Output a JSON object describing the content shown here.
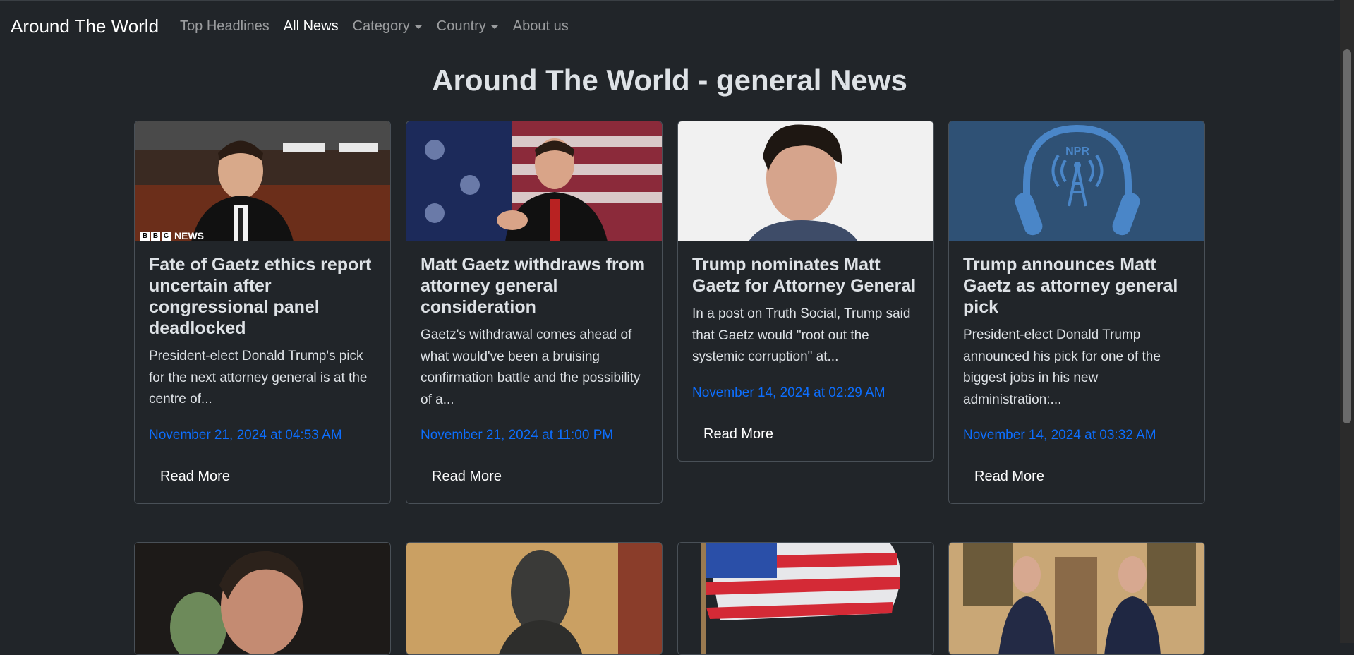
{
  "navbar": {
    "brand": "Around The World",
    "items": [
      {
        "label": "Top Headlines",
        "active": false,
        "dropdown": false
      },
      {
        "label": "All News",
        "active": true,
        "dropdown": false
      },
      {
        "label": "Category",
        "active": false,
        "dropdown": true
      },
      {
        "label": "Country",
        "active": false,
        "dropdown": true
      },
      {
        "label": "About us",
        "active": false,
        "dropdown": false
      }
    ]
  },
  "page": {
    "title": "Around The World - general News"
  },
  "cards": [
    {
      "image_badge": "NEWS",
      "title": "Fate of Gaetz ethics report uncertain after congressional panel deadlocked",
      "description": "President-elect Donald Trump's pick for the next attorney general is at the centre of...",
      "date": "November 21, 2024 at 04:53 AM",
      "button": "Read More"
    },
    {
      "title": "Matt Gaetz withdraws from attorney general consideration",
      "description": "Gaetz's withdrawal comes ahead of what would've been a bruising confirmation battle and the possibility of a...",
      "date": "November 21, 2024 at 11:00 PM",
      "button": "Read More"
    },
    {
      "title": "Trump nominates Matt Gaetz for Attorney General",
      "description": "In a post on Truth Social, Trump said that Gaetz would \"root out the systemic corruption\" at...",
      "date": "November 14, 2024 at 02:29 AM",
      "button": "Read More"
    },
    {
      "image_label": "NPR",
      "title": "Trump announces Matt Gaetz as attorney general pick",
      "description": "President-elect Donald Trump announced his pick for one of the biggest jobs in his new administration:...",
      "date": "November 14, 2024 at 03:32 AM",
      "button": "Read More"
    }
  ],
  "colors": {
    "background": "#212529",
    "link": "#0d6efd",
    "card_border": "#495057"
  }
}
